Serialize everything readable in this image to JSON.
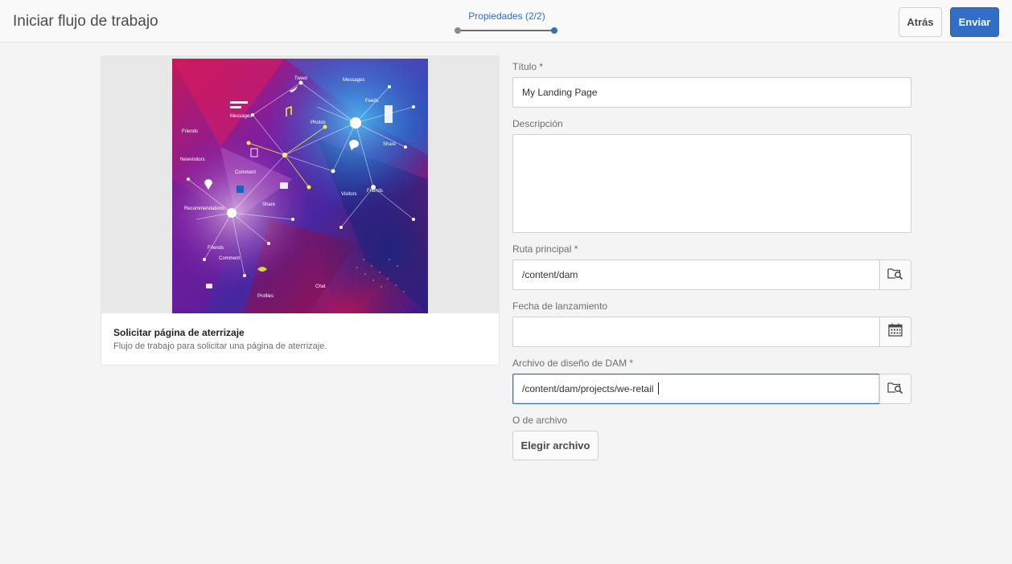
{
  "header": {
    "title": "Iniciar flujo de trabajo",
    "wizard_step_label": "Propiedades (2/2)",
    "back_label": "Atrás",
    "submit_label": "Enviar"
  },
  "card": {
    "thumbnail_words": [
      "Tweet",
      "Messages",
      "Feeds",
      "Messages",
      "Friends",
      "Photos",
      "Share",
      "Newvisitors",
      "Comment",
      "Visitors",
      "Friends",
      "Recommendations",
      "Share",
      "Friends",
      "Comment",
      "Profiles",
      "Chat"
    ],
    "title": "Solicitar página de aterrizaje",
    "description": "Flujo de trabajo para solicitar una página de aterrizaje."
  },
  "form": {
    "title_label": "Título *",
    "title_value": "My Landing Page",
    "description_label": "Descripción",
    "description_value": "",
    "root_path_label": "Ruta principal *",
    "root_path_value": "/content/dam",
    "launch_date_label": "Fecha de lanzamiento",
    "launch_date_value": "",
    "dam_design_label": "Archivo de diseño de DAM *",
    "dam_design_value": "/content/dam/projects/we-retail",
    "or_file_label": "O de archivo",
    "choose_file_label": "Elegir archivo"
  },
  "icons": {
    "browse": "folder-search-icon",
    "calendar": "calendar-icon"
  },
  "colors": {
    "accent": "#326ec8",
    "background": "#f4f4f4"
  }
}
